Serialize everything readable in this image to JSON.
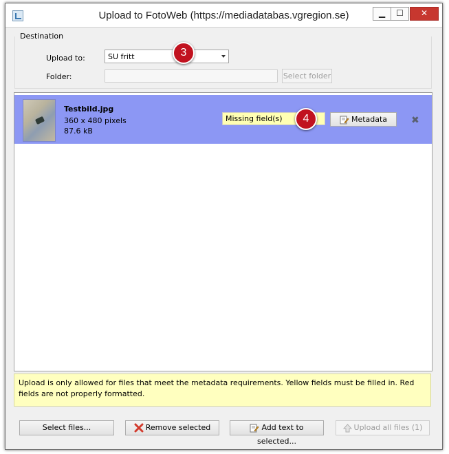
{
  "window": {
    "title": "Upload to FotoWeb (https://mediadatabas.vgregion.se)",
    "controls": {
      "minimize": "▁",
      "maximize": "☐",
      "close": "✕"
    }
  },
  "destination": {
    "legend": "Destination",
    "upload_to_label": "Upload to:",
    "upload_to_value": "SU fritt",
    "folder_label": "Folder:",
    "folder_value": "",
    "select_folder_label": "Select folder"
  },
  "callouts": {
    "first": "3",
    "second": "4"
  },
  "files": [
    {
      "name": "Testbild.jpg",
      "dimensions": "360 x 480 pixels",
      "size": "87.6 kB",
      "status": "Missing field(s)",
      "metadata_label": "Metadata"
    }
  ],
  "info_text": "Upload is only allowed for files that meet the metadata requirements. Yellow fields must be filled in. Red fields are not properly formatted.",
  "footer": {
    "select_files": "Select files...",
    "remove_selected": "Remove selected",
    "add_text": "Add text to selected...",
    "upload_all": "Upload all files (1)"
  },
  "colors": {
    "selected_row": "#8c97f4",
    "missing_field": "#ffffb3",
    "info_bg": "#ffffbf",
    "callout": "#c1121f",
    "close_button": "#c7372f"
  }
}
